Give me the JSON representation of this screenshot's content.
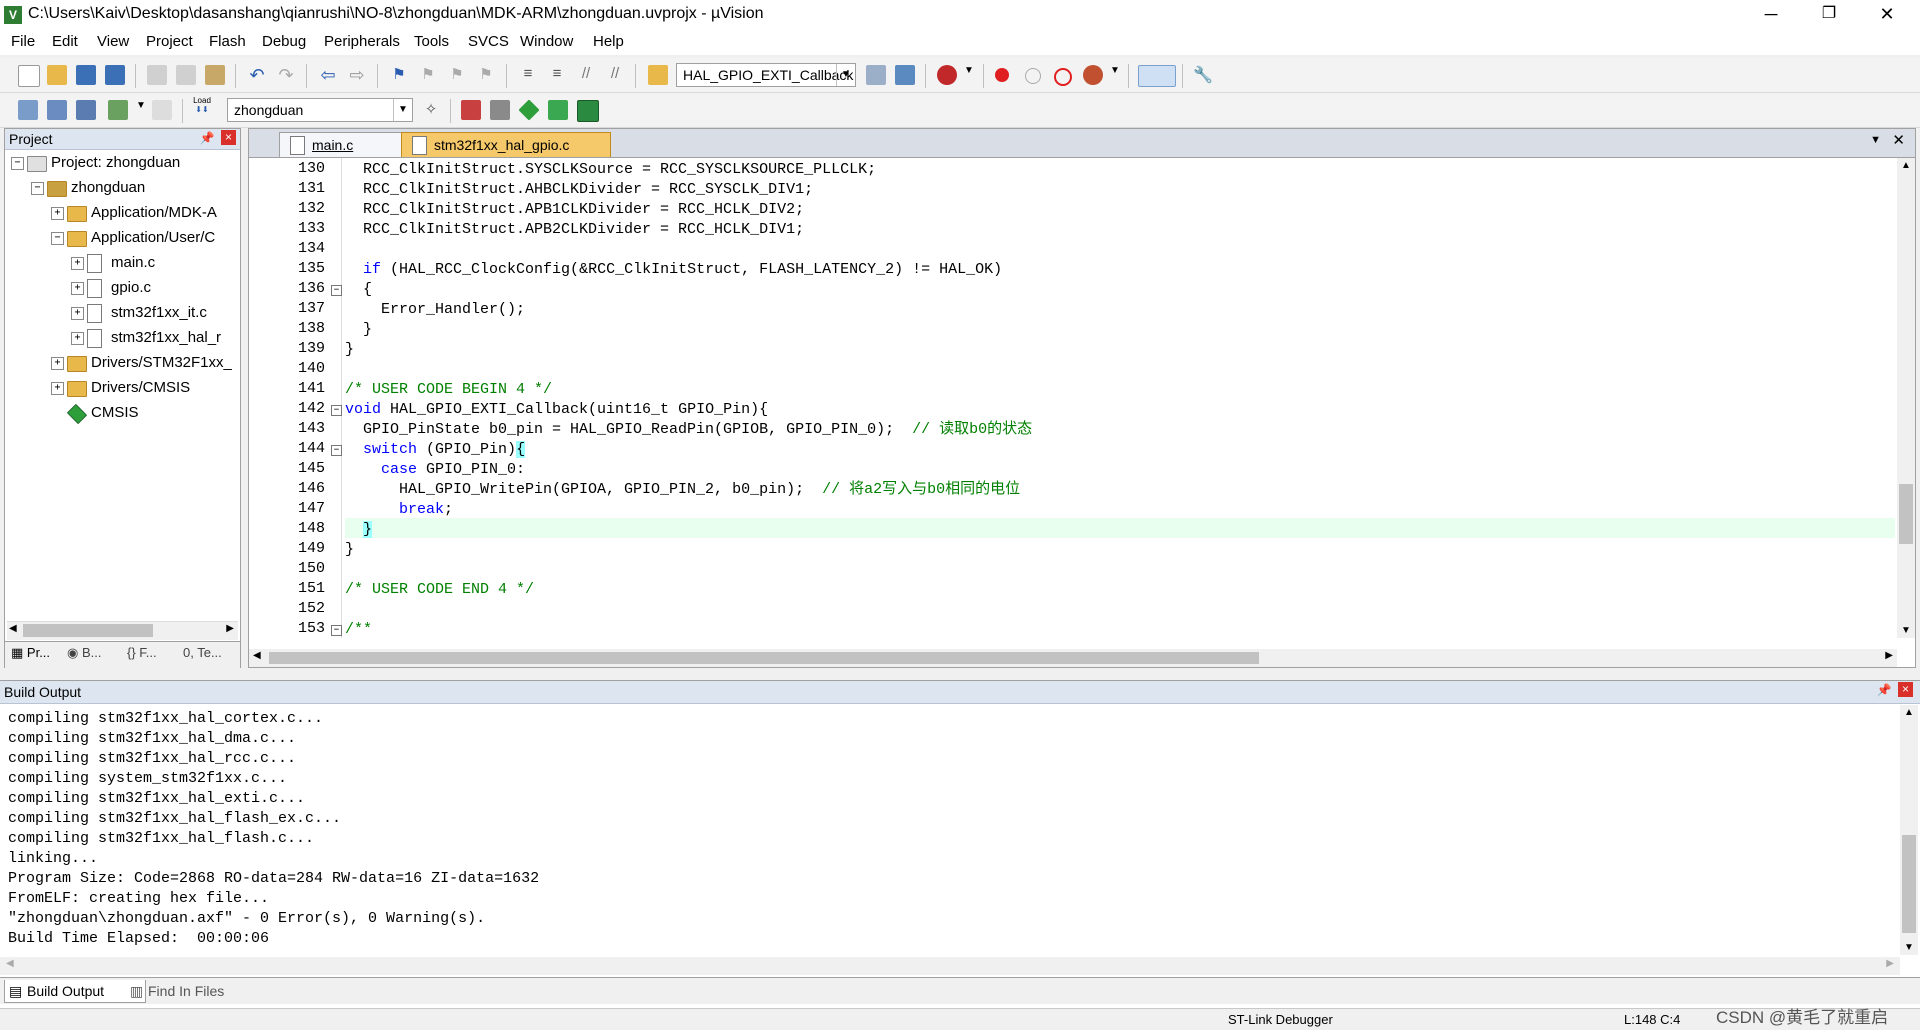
{
  "window": {
    "title": "C:\\Users\\Kaiv\\Desktop\\dasanshang\\qianrushi\\NO-8\\zhongduan\\MDK-ARM\\zhongduan.uvprojx - µVision",
    "minimize": "─",
    "restore": "❐",
    "close": "✕"
  },
  "menu": [
    "File",
    "Edit",
    "View",
    "Project",
    "Flash",
    "Debug",
    "Peripherals",
    "Tools",
    "SVCS",
    "Window",
    "Help"
  ],
  "toolbar": {
    "find_combo_value": "HAL_GPIO_EXTI_Callback",
    "target_combo_value": "zhongduan",
    "load_label": "Load"
  },
  "project_panel": {
    "title": "Project",
    "tree": [
      {
        "label": "Project: zhongduan",
        "level": 0,
        "type": "project",
        "expander": "−"
      },
      {
        "label": "zhongduan",
        "level": 1,
        "type": "target",
        "expander": "−"
      },
      {
        "label": "Application/MDK-A",
        "level": 2,
        "type": "folder",
        "expander": "+"
      },
      {
        "label": "Application/User/C",
        "level": 2,
        "type": "folder",
        "expander": "−"
      },
      {
        "label": "main.c",
        "level": 3,
        "type": "file",
        "expander": "+"
      },
      {
        "label": "gpio.c",
        "level": 3,
        "type": "file",
        "expander": "+"
      },
      {
        "label": "stm32f1xx_it.c",
        "level": 3,
        "type": "file",
        "expander": "+"
      },
      {
        "label": "stm32f1xx_hal_r",
        "level": 3,
        "type": "file",
        "expander": "+"
      },
      {
        "label": "Drivers/STM32F1xx_",
        "level": 2,
        "type": "folder",
        "expander": "+"
      },
      {
        "label": "Drivers/CMSIS",
        "level": 2,
        "type": "folder",
        "expander": "+"
      },
      {
        "label": "CMSIS",
        "level": 2,
        "type": "cmsis",
        "expander": ""
      }
    ],
    "tabs": [
      "Pr...",
      "B...",
      "{} F...",
      "0, Te..."
    ]
  },
  "editor": {
    "tabs": [
      {
        "label": "main.c",
        "active": false
      },
      {
        "label": "stm32f1xx_hal_gpio.c",
        "active": true
      }
    ],
    "current_line": 148,
    "lines": [
      {
        "no": "130",
        "fold": "",
        "parts": [
          {
            "t": "  RCC_ClkInitStruct.SYSCLKSource = RCC_SYSCLKSOURCE_PLLCLK;",
            "c": ""
          }
        ]
      },
      {
        "no": "131",
        "fold": "",
        "parts": [
          {
            "t": "  RCC_ClkInitStruct.AHBCLKDivider = RCC_SYSCLK_DIV1;",
            "c": ""
          }
        ]
      },
      {
        "no": "132",
        "fold": "",
        "parts": [
          {
            "t": "  RCC_ClkInitStruct.APB1CLKDivider = RCC_HCLK_DIV2;",
            "c": ""
          }
        ]
      },
      {
        "no": "133",
        "fold": "",
        "parts": [
          {
            "t": "  RCC_ClkInitStruct.APB2CLKDivider = RCC_HCLK_DIV1;",
            "c": ""
          }
        ]
      },
      {
        "no": "134",
        "fold": "",
        "parts": []
      },
      {
        "no": "135",
        "fold": "",
        "parts": [
          {
            "t": "  ",
            "c": ""
          },
          {
            "t": "if",
            "c": "kw"
          },
          {
            "t": " (HAL_RCC_ClockConfig(&RCC_ClkInitStruct, FLASH_LATENCY_2) != HAL_OK)",
            "c": ""
          }
        ]
      },
      {
        "no": "136",
        "fold": "−",
        "parts": [
          {
            "t": "  {",
            "c": ""
          }
        ]
      },
      {
        "no": "137",
        "fold": "",
        "parts": [
          {
            "t": "    Error_Handler();",
            "c": ""
          }
        ]
      },
      {
        "no": "138",
        "fold": "",
        "parts": [
          {
            "t": "  }",
            "c": ""
          }
        ]
      },
      {
        "no": "139",
        "fold": "",
        "parts": [
          {
            "t": "}",
            "c": ""
          }
        ]
      },
      {
        "no": "140",
        "fold": "",
        "parts": []
      },
      {
        "no": "141",
        "fold": "",
        "parts": [
          {
            "t": "/* USER CODE BEGIN 4 */",
            "c": "cm"
          }
        ]
      },
      {
        "no": "142",
        "fold": "−",
        "parts": [
          {
            "t": "void",
            "c": "kw"
          },
          {
            "t": " HAL_GPIO_EXTI_Callback(uint16_t GPIO_Pin){",
            "c": ""
          }
        ]
      },
      {
        "no": "143",
        "fold": "",
        "parts": [
          {
            "t": "  GPIO_PinState b0_pin = HAL_GPIO_ReadPin(GPIOB, GPIO_PIN_0);  ",
            "c": ""
          },
          {
            "t": "// 读取b0的状态",
            "c": "cm"
          }
        ]
      },
      {
        "no": "144",
        "fold": "−",
        "parts": [
          {
            "t": "  ",
            "c": ""
          },
          {
            "t": "switch",
            "c": "kw"
          },
          {
            "t": " (GPIO_Pin)",
            "c": ""
          },
          {
            "t": "{",
            "c": "brace-hl"
          }
        ]
      },
      {
        "no": "145",
        "fold": "",
        "parts": [
          {
            "t": "    ",
            "c": ""
          },
          {
            "t": "case",
            "c": "kw"
          },
          {
            "t": " GPIO_PIN_0:",
            "c": ""
          }
        ]
      },
      {
        "no": "146",
        "fold": "",
        "parts": [
          {
            "t": "      HAL_GPIO_WritePin(GPIOA, GPIO_PIN_2, b0_pin);  ",
            "c": ""
          },
          {
            "t": "// 将a2写入与b0相同的电位",
            "c": "cm"
          }
        ]
      },
      {
        "no": "147",
        "fold": "",
        "parts": [
          {
            "t": "      ",
            "c": ""
          },
          {
            "t": "break",
            "c": "kw"
          },
          {
            "t": ";",
            "c": ""
          }
        ]
      },
      {
        "no": "148",
        "fold": "",
        "parts": [
          {
            "t": "  ",
            "c": ""
          },
          {
            "t": "}",
            "c": "brace-hl"
          }
        ]
      },
      {
        "no": "149",
        "fold": "",
        "parts": [
          {
            "t": "}",
            "c": ""
          }
        ]
      },
      {
        "no": "150",
        "fold": "",
        "parts": []
      },
      {
        "no": "151",
        "fold": "",
        "parts": [
          {
            "t": "/* USER CODE END 4 */",
            "c": "cm"
          }
        ]
      },
      {
        "no": "152",
        "fold": "",
        "parts": []
      },
      {
        "no": "153",
        "fold": "−",
        "parts": [
          {
            "t": "/**",
            "c": "cm"
          }
        ]
      }
    ]
  },
  "build_output": {
    "title": "Build Output",
    "lines": [
      "compiling stm32f1xx_hal_cortex.c...",
      "compiling stm32f1xx_hal_dma.c...",
      "compiling stm32f1xx_hal_rcc.c...",
      "compiling system_stm32f1xx.c...",
      "compiling stm32f1xx_hal_exti.c...",
      "compiling stm32f1xx_hal_flash_ex.c...",
      "compiling stm32f1xx_hal_flash.c...",
      "linking...",
      "Program Size: Code=2868 RO-data=284 RW-data=16 ZI-data=1632",
      "FromELF: creating hex file...",
      "\"zhongduan\\zhongduan.axf\" - 0 Error(s), 0 Warning(s).",
      "Build Time Elapsed:  00:00:06"
    ],
    "tabs": [
      "Build Output",
      "Find In Files"
    ]
  },
  "status": {
    "debugger": "ST-Link Debugger",
    "position": "L:148 C:4",
    "watermark": "CSDN @黄毛了就重启"
  },
  "colors": {
    "keyword": "#0000ff",
    "comment": "#008000",
    "current_line": "#e8fff0",
    "active_tab": "#f5c86a"
  }
}
